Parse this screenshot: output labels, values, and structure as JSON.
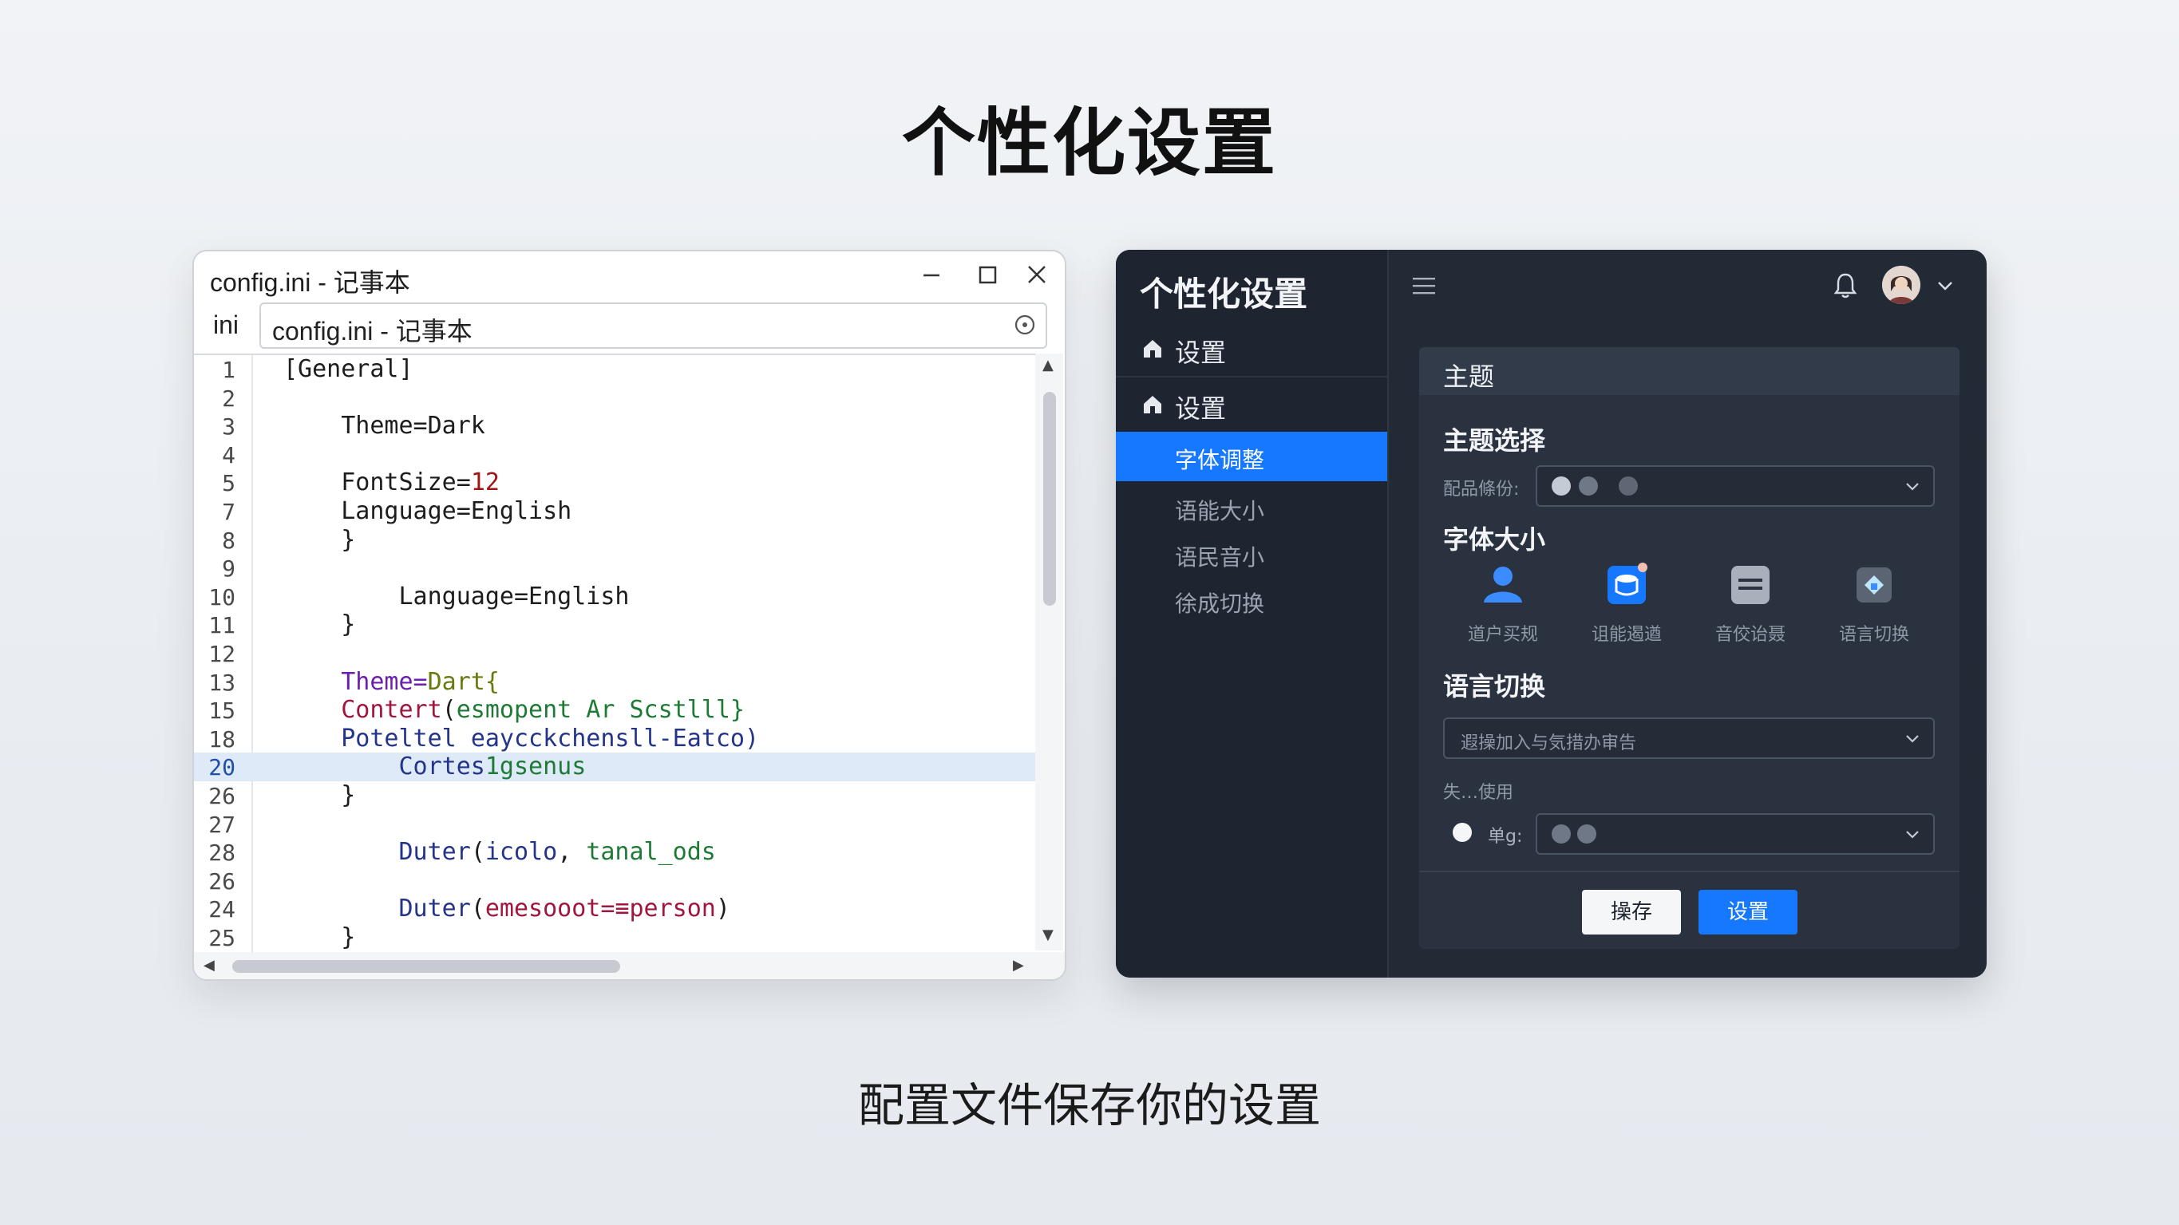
{
  "page": {
    "title": "个性化设置",
    "caption": "配置文件保存你的设置"
  },
  "notepad": {
    "title": "config.ini - 记事本",
    "address_label": "ini",
    "address_value": "config.ini - 记事本",
    "lines": [
      {
        "n": "1",
        "text": "[General]"
      },
      {
        "n": "2",
        "text": ""
      },
      {
        "n": "3",
        "text": "    Theme=Dark"
      },
      {
        "n": "4",
        "text": ""
      },
      {
        "n": "5",
        "text": "    FontSize=12"
      },
      {
        "n": "7",
        "text": "    Language=English"
      },
      {
        "n": "8",
        "text": "    }"
      },
      {
        "n": "9",
        "text": ""
      },
      {
        "n": "10",
        "text": "        Language=English"
      },
      {
        "n": "11",
        "text": "    }"
      },
      {
        "n": "12",
        "text": ""
      },
      {
        "n": "13",
        "text": "    Theme=Dart{"
      },
      {
        "n": "15",
        "text": "    Contert(esmopent Ar Scstlll}"
      },
      {
        "n": "18",
        "text": "    Poteltel eaycckchensll-Eatco)"
      },
      {
        "n": "20",
        "text": "        Cortes1gsenus"
      },
      {
        "n": "26",
        "text": "    }"
      },
      {
        "n": "27",
        "text": ""
      },
      {
        "n": "28",
        "text": "        Duter(icolo, tanal_ods"
      },
      {
        "n": "26",
        "text": ""
      },
      {
        "n": "24",
        "text": "        Duter(emesooot=≡person)"
      },
      {
        "n": "25",
        "text": "    }"
      }
    ],
    "highlight_line_index": 14
  },
  "app": {
    "brand": "个性化设置",
    "nav": [
      {
        "label": "设置"
      },
      {
        "label": "设置"
      }
    ],
    "subnav": [
      "字体调整",
      "语能大小",
      "语民音小",
      "徐成切换"
    ],
    "panel": {
      "header": "主题",
      "theme_heading": "主题选择",
      "theme_label": "配品條份:",
      "font_heading": "字体大小",
      "options": [
        {
          "label": "道户买规",
          "icon": "user-icon"
        },
        {
          "label": "诅能遏遒",
          "icon": "database-icon"
        },
        {
          "label": "音佼诒聂",
          "icon": "document-icon"
        },
        {
          "label": "语言切换",
          "icon": "translate-icon"
        }
      ],
      "language_heading": "语言切换",
      "language_placeholder": "遐操加入与気措办审告",
      "small_label": "失…使用",
      "radio_label": "单g:",
      "btn_secondary": "操存",
      "btn_primary": "设置"
    },
    "colors": {
      "accent": "#1677ff",
      "bg": "#222a36",
      "sidebar": "#1e2530"
    }
  }
}
